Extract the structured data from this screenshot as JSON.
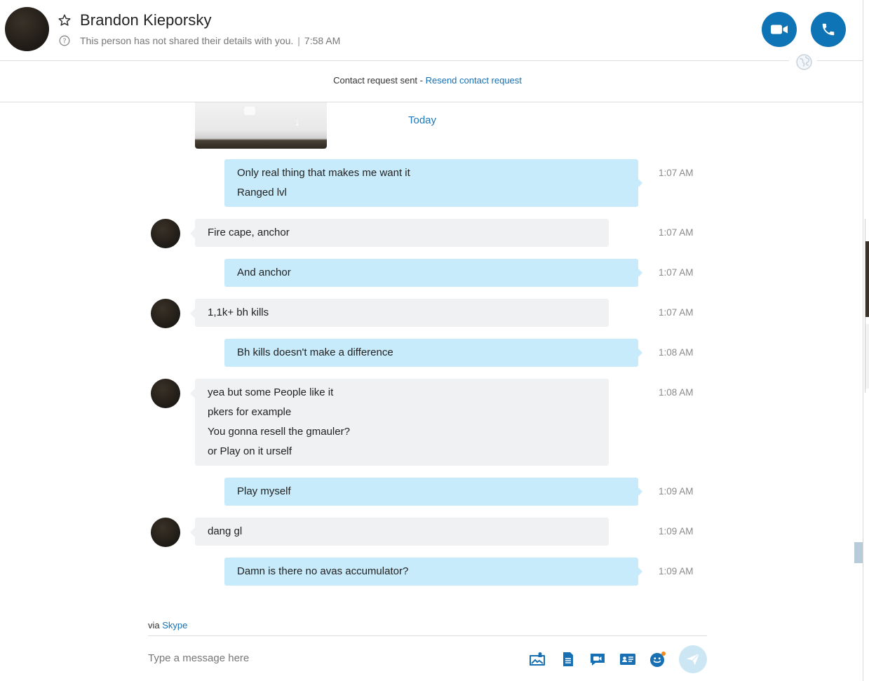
{
  "header": {
    "contact_name": "Brandon Kieporsky",
    "status_text": "This person has not shared their details with you.",
    "last_seen": "7:58 AM",
    "separator": "|"
  },
  "contact_request": {
    "text": "Contact request sent - ",
    "link": "Resend contact request"
  },
  "day_label": "Today",
  "messages": [
    {
      "direction": "outgoing",
      "lines": [
        "Only real thing that makes me want it",
        "Ranged lvl"
      ],
      "time": "1:07 AM"
    },
    {
      "direction": "incoming",
      "lines": [
        "Fire cape, anchor"
      ],
      "time": "1:07 AM"
    },
    {
      "direction": "outgoing",
      "lines": [
        "And anchor"
      ],
      "time": "1:07 AM"
    },
    {
      "direction": "incoming",
      "lines": [
        "1,1k+ bh kills"
      ],
      "time": "1:07 AM"
    },
    {
      "direction": "outgoing",
      "lines": [
        "Bh kills doesn't make a difference"
      ],
      "time": "1:08 AM"
    },
    {
      "direction": "incoming",
      "lines": [
        "yea but some People like it",
        "pkers for example",
        "You gonna resell the gmauler?",
        "or Play on it urself"
      ],
      "time": "1:08 AM"
    },
    {
      "direction": "outgoing",
      "lines": [
        "Play myself"
      ],
      "time": "1:09 AM"
    },
    {
      "direction": "incoming",
      "lines": [
        "dang gl"
      ],
      "time": "1:09 AM"
    },
    {
      "direction": "outgoing",
      "lines": [
        "Damn is there no avas accumulator?"
      ],
      "time": "1:09 AM"
    }
  ],
  "footer": {
    "via_prefix": "via ",
    "via_link": "Skype",
    "compose_placeholder": "Type a message here"
  },
  "icons": {
    "favorite": "star-icon",
    "help": "question-circle-icon",
    "video_call": "video-camera-icon",
    "audio_call": "phone-icon",
    "globe": "globe-icon",
    "media": "media-gallery-icon",
    "file": "file-icon",
    "video_message": "video-message-icon",
    "contact_card": "contact-card-icon",
    "emoticon": "emoticon-icon",
    "send": "send-icon"
  },
  "colors": {
    "accent": "#0f74b5",
    "outgoing_bubble": "#c7ebfa",
    "incoming_bubble": "#f0f1f3",
    "link": "#1670b3"
  }
}
